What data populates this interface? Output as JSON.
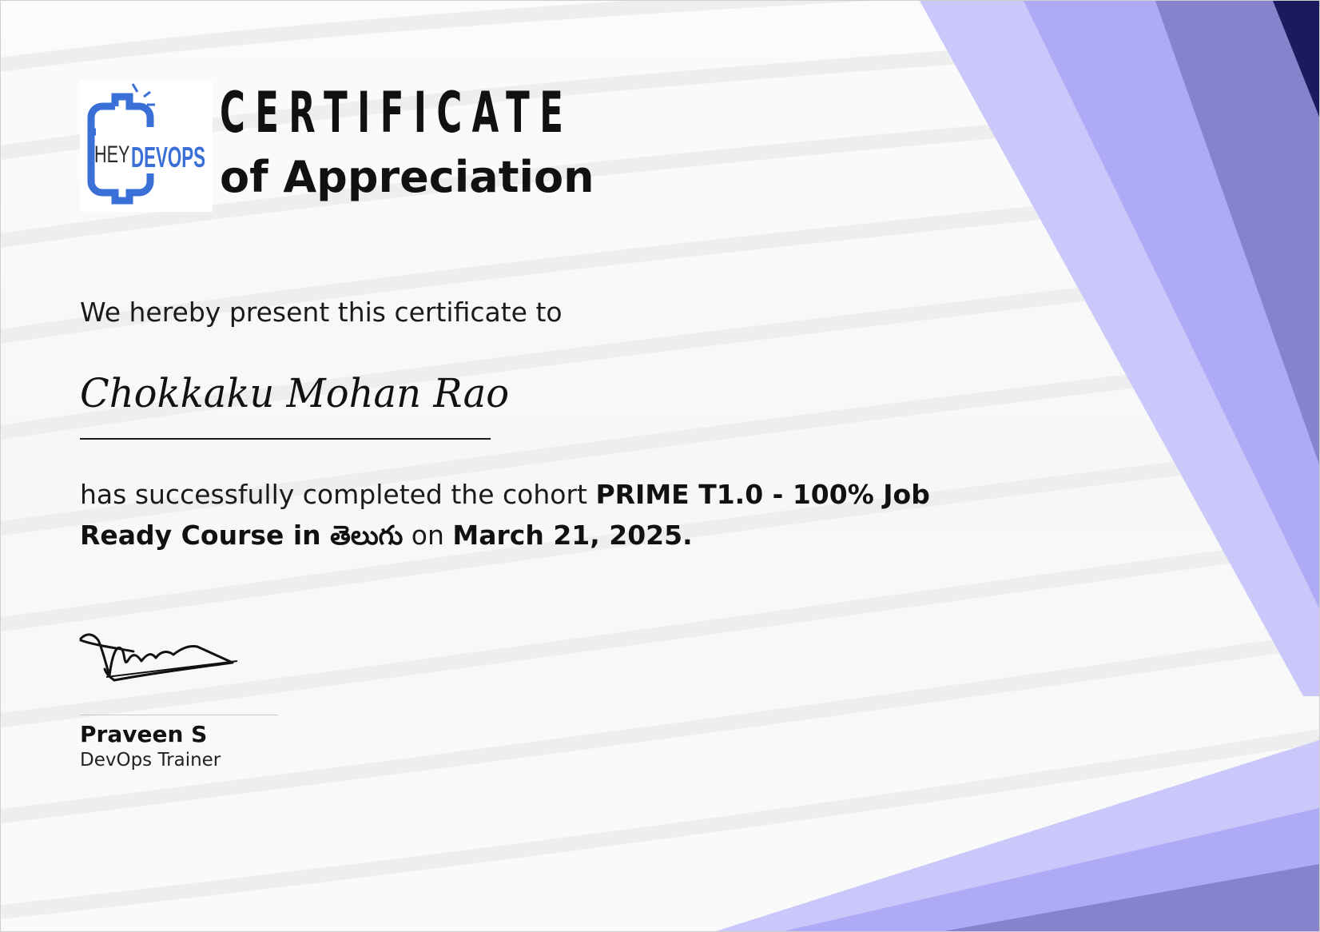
{
  "logo": {
    "text_left": "HEY",
    "text_right": "DEVOPS",
    "color": "#3a6fd8"
  },
  "title": {
    "main": "CERTIFICATE",
    "sub": "of Appreciation"
  },
  "intro": "We hereby present this certificate to",
  "recipient": "Chokkaku Mohan Rao",
  "body": {
    "prefix": "has successfully completed the cohort ",
    "course": "PRIME T1.0 - 100% Job Ready Course in తెలుగు",
    "middle": " on ",
    "date": "March 21, 2025."
  },
  "signer": {
    "name": "Praveen S",
    "role": "DevOps Trainer"
  },
  "colors": {
    "accent_light": "#cac7fb",
    "accent_mid": "#aeaaf5",
    "accent_dark": "#8683cc",
    "accent_navy": "#1c1a5e"
  }
}
